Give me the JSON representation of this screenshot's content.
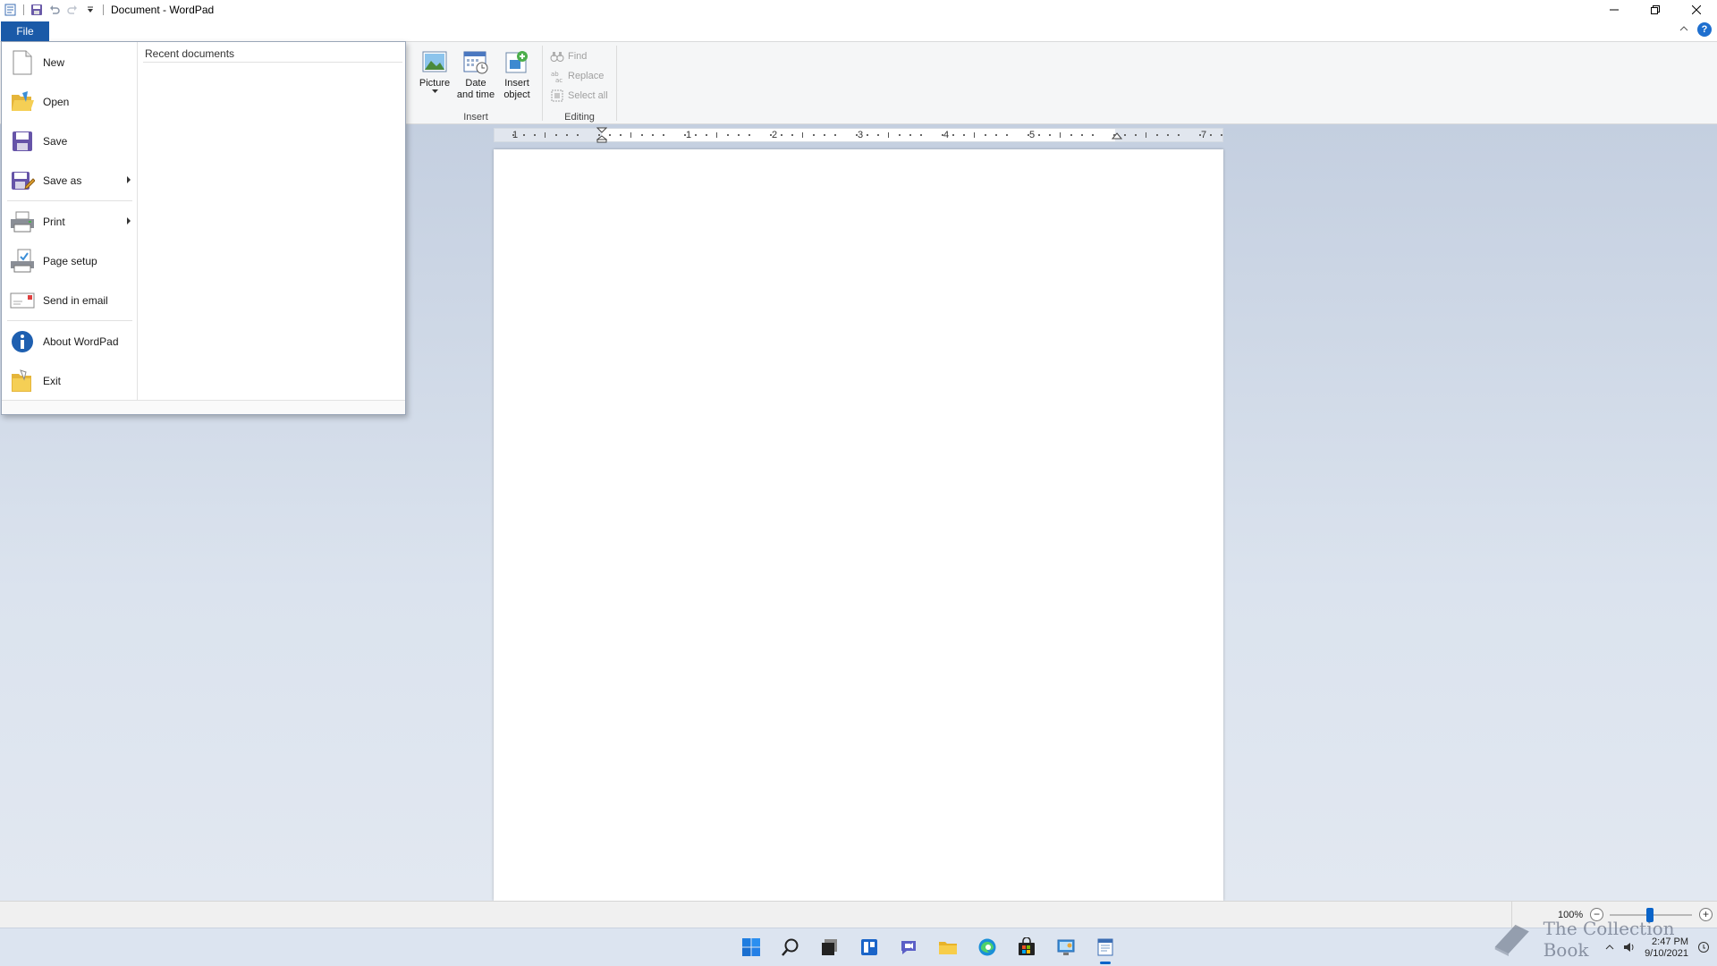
{
  "window": {
    "title": "Document - WordPad"
  },
  "file_tab": {
    "label": "File"
  },
  "file_menu": {
    "items": [
      {
        "label": "New",
        "icon": "new-document-icon"
      },
      {
        "label": "Open",
        "icon": "open-folder-icon"
      },
      {
        "label": "Save",
        "icon": "save-icon"
      },
      {
        "label": "Save as",
        "icon": "save-as-icon",
        "submenu": true
      },
      {
        "label": "Print",
        "icon": "printer-icon",
        "submenu": true
      },
      {
        "label": "Page setup",
        "icon": "page-setup-icon"
      },
      {
        "label": "Send in email",
        "icon": "email-icon"
      },
      {
        "label": "About WordPad",
        "icon": "info-icon"
      },
      {
        "label": "Exit",
        "icon": "exit-icon"
      }
    ],
    "recent_header": "Recent documents"
  },
  "ribbon": {
    "insert_group": {
      "label": "Insert",
      "picture": "Picture",
      "date_time": "Date and time",
      "insert_object": "Insert object"
    },
    "editing_group": {
      "label": "Editing",
      "find": "Find",
      "replace": "Replace",
      "select_all": "Select all"
    }
  },
  "ruler": {
    "labels": [
      "1",
      "1",
      "2",
      "3",
      "4",
      "5",
      "7"
    ]
  },
  "statusbar": {
    "zoom": "100%",
    "zoom_level": 1.0
  },
  "taskbar": {
    "icons": [
      "windows-start-icon",
      "search-icon",
      "task-view-icon",
      "widgets-icon",
      "chat-icon",
      "file-explorer-icon",
      "edge-icon",
      "store-icon",
      "control-panel-icon",
      "wordpad-icon"
    ],
    "time": "2:47 PM",
    "date": "9/10/2021"
  },
  "watermark": {
    "text": "The Collection Book"
  },
  "colors": {
    "accent": "#1a5aa8",
    "workspace_top": "#c4cfe0",
    "workspace_bottom": "#e2e8f1"
  }
}
